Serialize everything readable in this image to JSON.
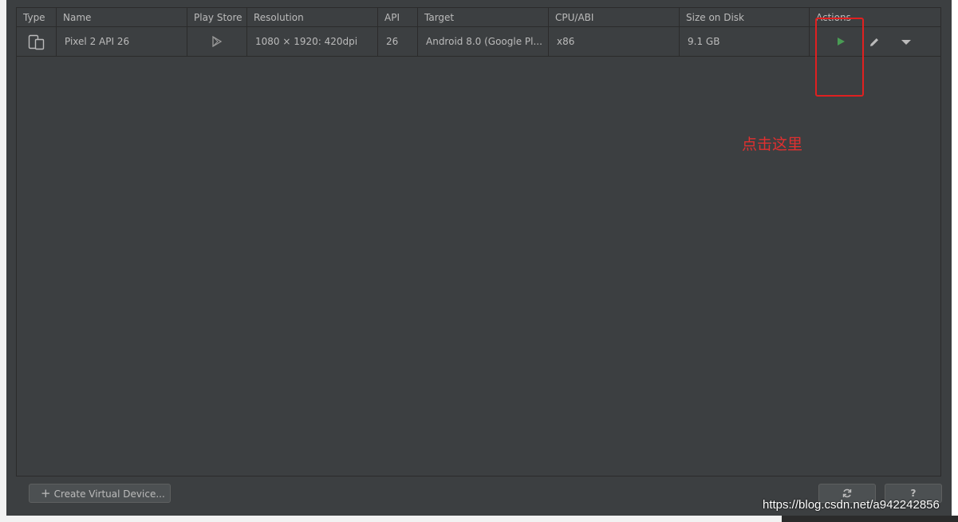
{
  "table": {
    "columns": [
      "Type",
      "Name",
      "Play Store",
      "Resolution",
      "API",
      "Target",
      "CPU/ABI",
      "Size on Disk",
      "Actions"
    ],
    "rows": [
      {
        "type_icon": "phone-tablet-icon",
        "name": "Pixel 2 API 26",
        "play_store_icon": "play-store-icon",
        "resolution": "1080 × 1920: 420dpi",
        "api": "26",
        "target": "Android 8.0 (Google Pl...",
        "cpu_abi": "x86",
        "size_on_disk": "9.1 GB",
        "actions": [
          "play-icon",
          "pencil-icon",
          "chevron-down-icon"
        ]
      }
    ]
  },
  "annotation": {
    "text": "点击这里",
    "color": "#e03030"
  },
  "footer": {
    "create_label": "Create Virtual Device...",
    "refresh_icon": "refresh-icon",
    "help_label": "?"
  },
  "watermark": "https://blog.csdn.net/a942242856",
  "colors": {
    "background": "#3c3f41",
    "play_green": "#499c54",
    "highlight_red": "#e02020"
  }
}
